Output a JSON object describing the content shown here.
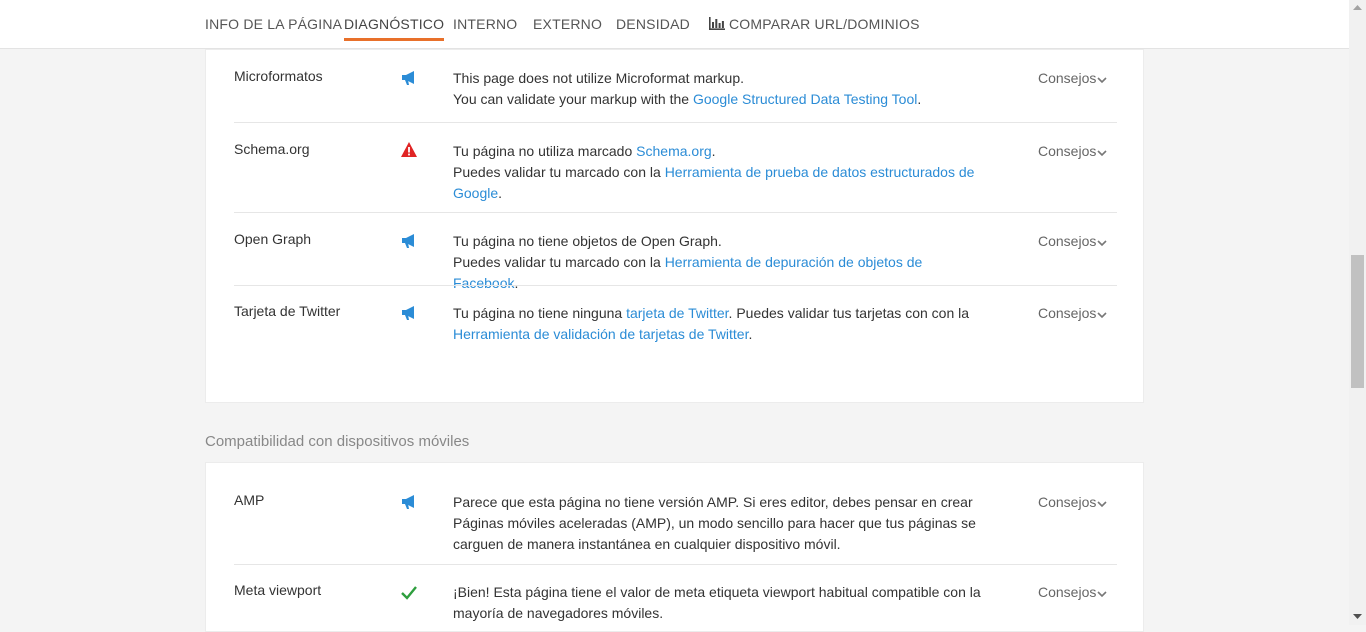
{
  "nav": {
    "tabs": [
      {
        "label": "INFO DE LA PÁGINA"
      },
      {
        "label": "DIAGNÓSTICO",
        "active": true
      },
      {
        "label": "INTERNO"
      },
      {
        "label": "EXTERNO"
      },
      {
        "label": "DENSIDAD"
      },
      {
        "label": "COMPARAR URL/DOMINIOS",
        "icon": "bar-chart-icon"
      }
    ]
  },
  "colors": {
    "accent": "#e8702a",
    "link": "#2b8cd6",
    "info": "#2b8cd6",
    "warning": "#e02424",
    "ok": "#2e9e3e"
  },
  "tips_label": "Consejos",
  "structured_data": {
    "rows": [
      {
        "name": "Microformatos",
        "status_icon": "megaphone-icon",
        "line1": "This page does not utilize Microformat markup.",
        "line2_pre": "You can validate your markup with the ",
        "line2_link": "Google Structured Data Testing Tool",
        "line2_post": "."
      },
      {
        "name": "Schema.org",
        "status_icon": "warning-icon",
        "line1_pre": "Tu página no utiliza marcado ",
        "line1_link": "Schema.org",
        "line1_post": ".",
        "line2_pre": "Puedes validar tu marcado con la ",
        "line2_link": "Herramienta de prueba de datos estructurados de Google",
        "line2_post": "."
      },
      {
        "name": "Open Graph",
        "status_icon": "megaphone-icon",
        "line1": "Tu página no tiene objetos de Open Graph.",
        "line2_pre": "Puedes validar tu marcado con la ",
        "line2_link": "Herramienta de depuración de objetos de Facebook",
        "line2_post": "."
      },
      {
        "name": "Tarjeta de Twitter",
        "status_icon": "megaphone-icon",
        "line1_pre": "Tu página no tiene ninguna ",
        "line1_link": "tarjeta de Twitter",
        "line1_post": ". Puedes validar tus tarjetas con con la ",
        "line2_link": "Herramienta de validación de tarjetas de Twitter",
        "line2_post": "."
      }
    ]
  },
  "mobile": {
    "section_title": "Compatibilidad con dispositivos móviles",
    "rows": [
      {
        "name": "AMP",
        "status_icon": "megaphone-icon",
        "text": "Parece que esta página no tiene versión AMP. Si eres editor, debes pensar en crear Páginas móviles aceleradas (AMP), un modo sencillo para hacer que tus páginas se carguen de manera instantánea en cualquier dispositivo móvil."
      },
      {
        "name": "Meta viewport",
        "status_icon": "checkmark-icon",
        "text": "¡Bien! Esta página tiene el valor de meta etiqueta viewport habitual compatible con la mayoría de navegadores móviles."
      }
    ]
  }
}
